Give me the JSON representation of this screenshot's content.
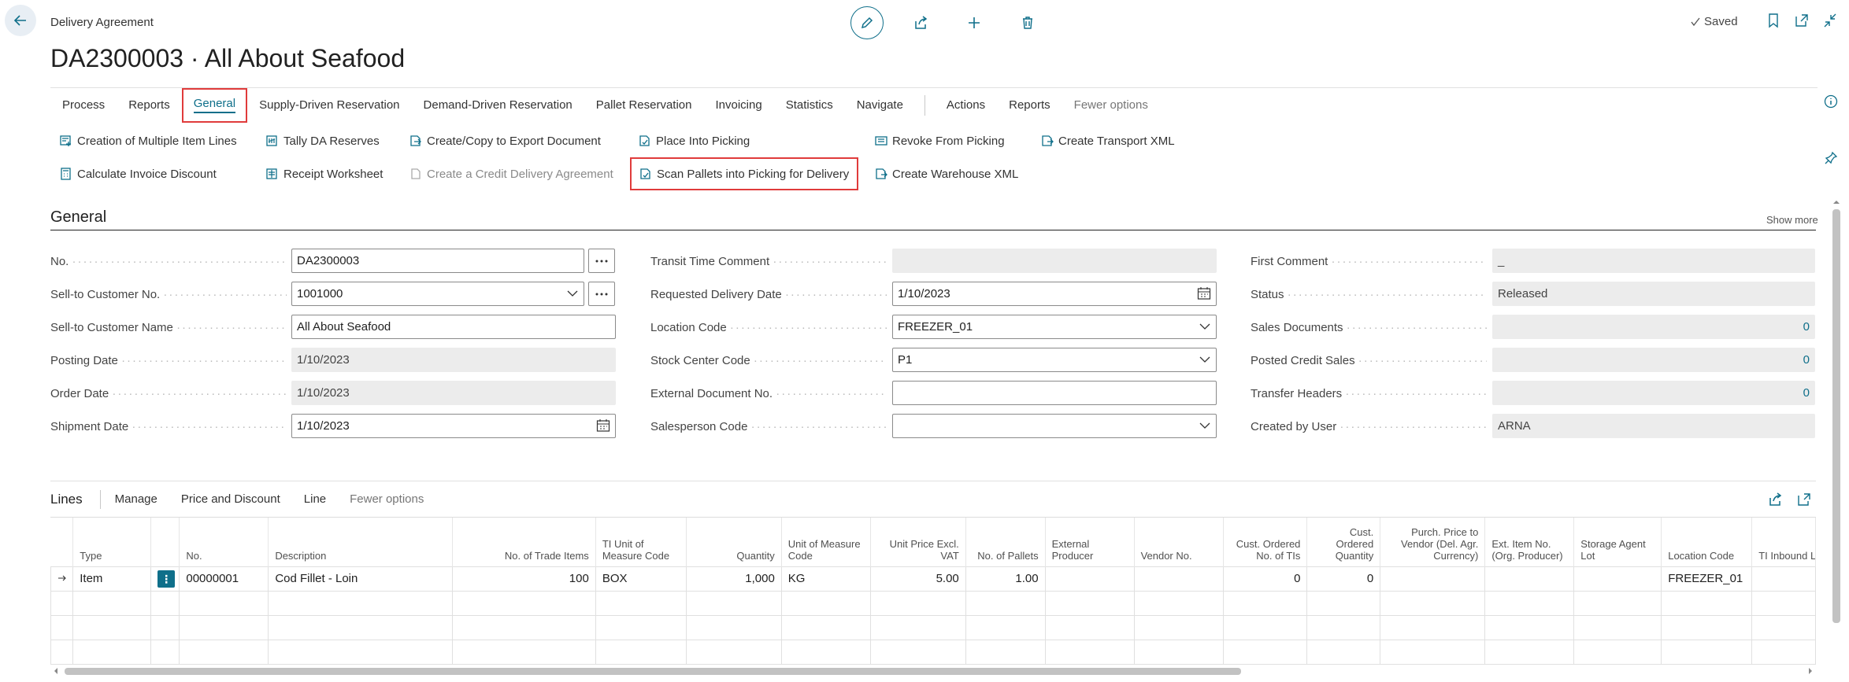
{
  "header": {
    "caption": "Delivery Agreement",
    "title": "DA2300003 · All About Seafood",
    "saved_label": "Saved"
  },
  "tabs": [
    {
      "label": "Process"
    },
    {
      "label": "Reports"
    },
    {
      "label": "General"
    },
    {
      "label": "Supply-Driven Reservation"
    },
    {
      "label": "Demand-Driven Reservation"
    },
    {
      "label": "Pallet Reservation"
    },
    {
      "label": "Invoicing"
    },
    {
      "label": "Statistics"
    },
    {
      "label": "Navigate"
    },
    {
      "label": "Actions"
    },
    {
      "label": "Reports"
    },
    {
      "label": "Fewer options"
    }
  ],
  "actions": {
    "creation_multiple": "Creation of Multiple Item Lines",
    "tally": "Tally DA Reserves",
    "create_copy_export": "Create/Copy to Export Document",
    "place_picking": "Place Into Picking",
    "revoke_picking": "Revoke From Picking",
    "create_transport_xml": "Create Transport XML",
    "calc_invoice_discount": "Calculate Invoice Discount",
    "receipt_worksheet": "Receipt Worksheet",
    "create_credit": "Create a Credit Delivery Agreement",
    "scan_pallets": "Scan Pallets into Picking for Delivery",
    "create_warehouse_xml": "Create Warehouse XML"
  },
  "general": {
    "section_title": "General",
    "show_more": "Show more",
    "fields": {
      "no": {
        "label": "No.",
        "value": "DA2300003"
      },
      "sell_to_customer_no": {
        "label": "Sell-to Customer No.",
        "value": "1001000"
      },
      "sell_to_customer_name": {
        "label": "Sell-to Customer Name",
        "value": "All About Seafood"
      },
      "posting_date": {
        "label": "Posting Date",
        "value": "1/10/2023"
      },
      "order_date": {
        "label": "Order Date",
        "value": "1/10/2023"
      },
      "shipment_date": {
        "label": "Shipment Date",
        "value": "1/10/2023"
      },
      "transit_time_comment": {
        "label": "Transit Time Comment",
        "value": ""
      },
      "requested_delivery_date": {
        "label": "Requested Delivery Date",
        "value": "1/10/2023"
      },
      "location_code": {
        "label": "Location Code",
        "value": "FREEZER_01"
      },
      "stock_center_code": {
        "label": "Stock Center Code",
        "value": "P1"
      },
      "external_document_no": {
        "label": "External Document No.",
        "value": ""
      },
      "salesperson_code": {
        "label": "Salesperson Code",
        "value": ""
      },
      "first_comment": {
        "label": "First Comment",
        "value": "_"
      },
      "status": {
        "label": "Status",
        "value": "Released"
      },
      "sales_documents": {
        "label": "Sales Documents",
        "value": "0"
      },
      "posted_credit_sales": {
        "label": "Posted Credit Sales",
        "value": "0"
      },
      "transfer_headers": {
        "label": "Transfer Headers",
        "value": "0"
      },
      "created_by_user": {
        "label": "Created by User",
        "value": "ARNA"
      }
    }
  },
  "lines": {
    "title": "Lines",
    "actions": [
      "Manage",
      "Price and Discount",
      "Line",
      "Fewer options"
    ],
    "columns": {
      "type": "Type",
      "no": "No.",
      "description": "Description",
      "no_trade_items": "No. of Trade Items",
      "ti_uom": "TI Unit of Measure Code",
      "quantity": "Quantity",
      "uom": "Unit of Measure Code",
      "unit_price": "Unit Price Excl. VAT",
      "no_pallets": "No. of Pallets",
      "external_producer": "External Producer",
      "vendor_no": "Vendor No.",
      "cust_ordered_tis": "Cust. Ordered No. of TIs",
      "cust_ordered_qty": "Cust. Ordered Quantity",
      "purch_price": "Purch. Price to Vendor (Del. Agr. Currency)",
      "ext_item_no": "Ext. Item No. (Org. Producer)",
      "storage_agent_lot": "Storage Agent Lot",
      "location_code": "Location Code",
      "ti_inbound": "TI Inbound L Code"
    },
    "rows": [
      {
        "type": "Item",
        "no": "00000001",
        "description": "Cod Fillet - Loin",
        "no_trade_items": "100",
        "ti_uom": "BOX",
        "quantity": "1,000",
        "uom": "KG",
        "unit_price": "5.00",
        "no_pallets": "1.00",
        "external_producer": "",
        "vendor_no": "",
        "cust_ordered_tis": "0",
        "cust_ordered_qty": "0",
        "purch_price": "",
        "ext_item_no": "",
        "storage_agent_lot": "",
        "location_code": "FREEZER_01",
        "ti_inbound": ""
      }
    ]
  },
  "colors": {
    "accent": "#0f6f8a",
    "highlight": "#e03b3b"
  }
}
